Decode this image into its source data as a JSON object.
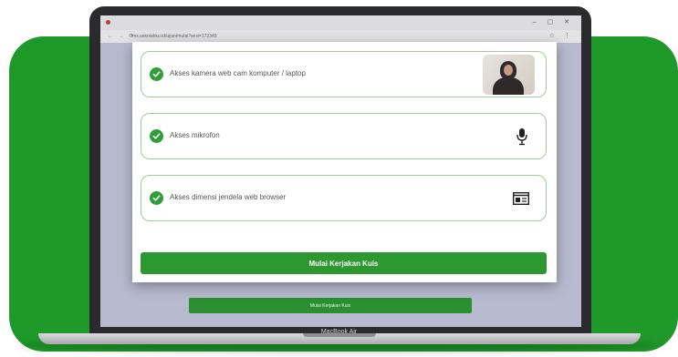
{
  "browser": {
    "url": "lms.sekolahku.id/ujian/mulai?sesi=172349",
    "window_controls": "– ▢ ✕",
    "nav_icons": "← → ⟳",
    "toolbar_icons": "☆ ⋮"
  },
  "permissions": [
    {
      "label": "Akses kamera web cam komputer / laptop",
      "icon": "webcam-preview"
    },
    {
      "label": "Akses mikrofon",
      "icon": "microphone-icon"
    },
    {
      "label": "Akses dimensi jendela web browser",
      "icon": "browser-window-icon"
    }
  ],
  "primary_button_label": "Mulai Kerjakan Kuis",
  "background_button_label": "Mulai Kerjakan Kuis",
  "device_label": "MacBook Air",
  "colors": {
    "brand_green": "#1f9a2a",
    "button_green": "#2d982f",
    "check_green": "#2f9e3a"
  }
}
